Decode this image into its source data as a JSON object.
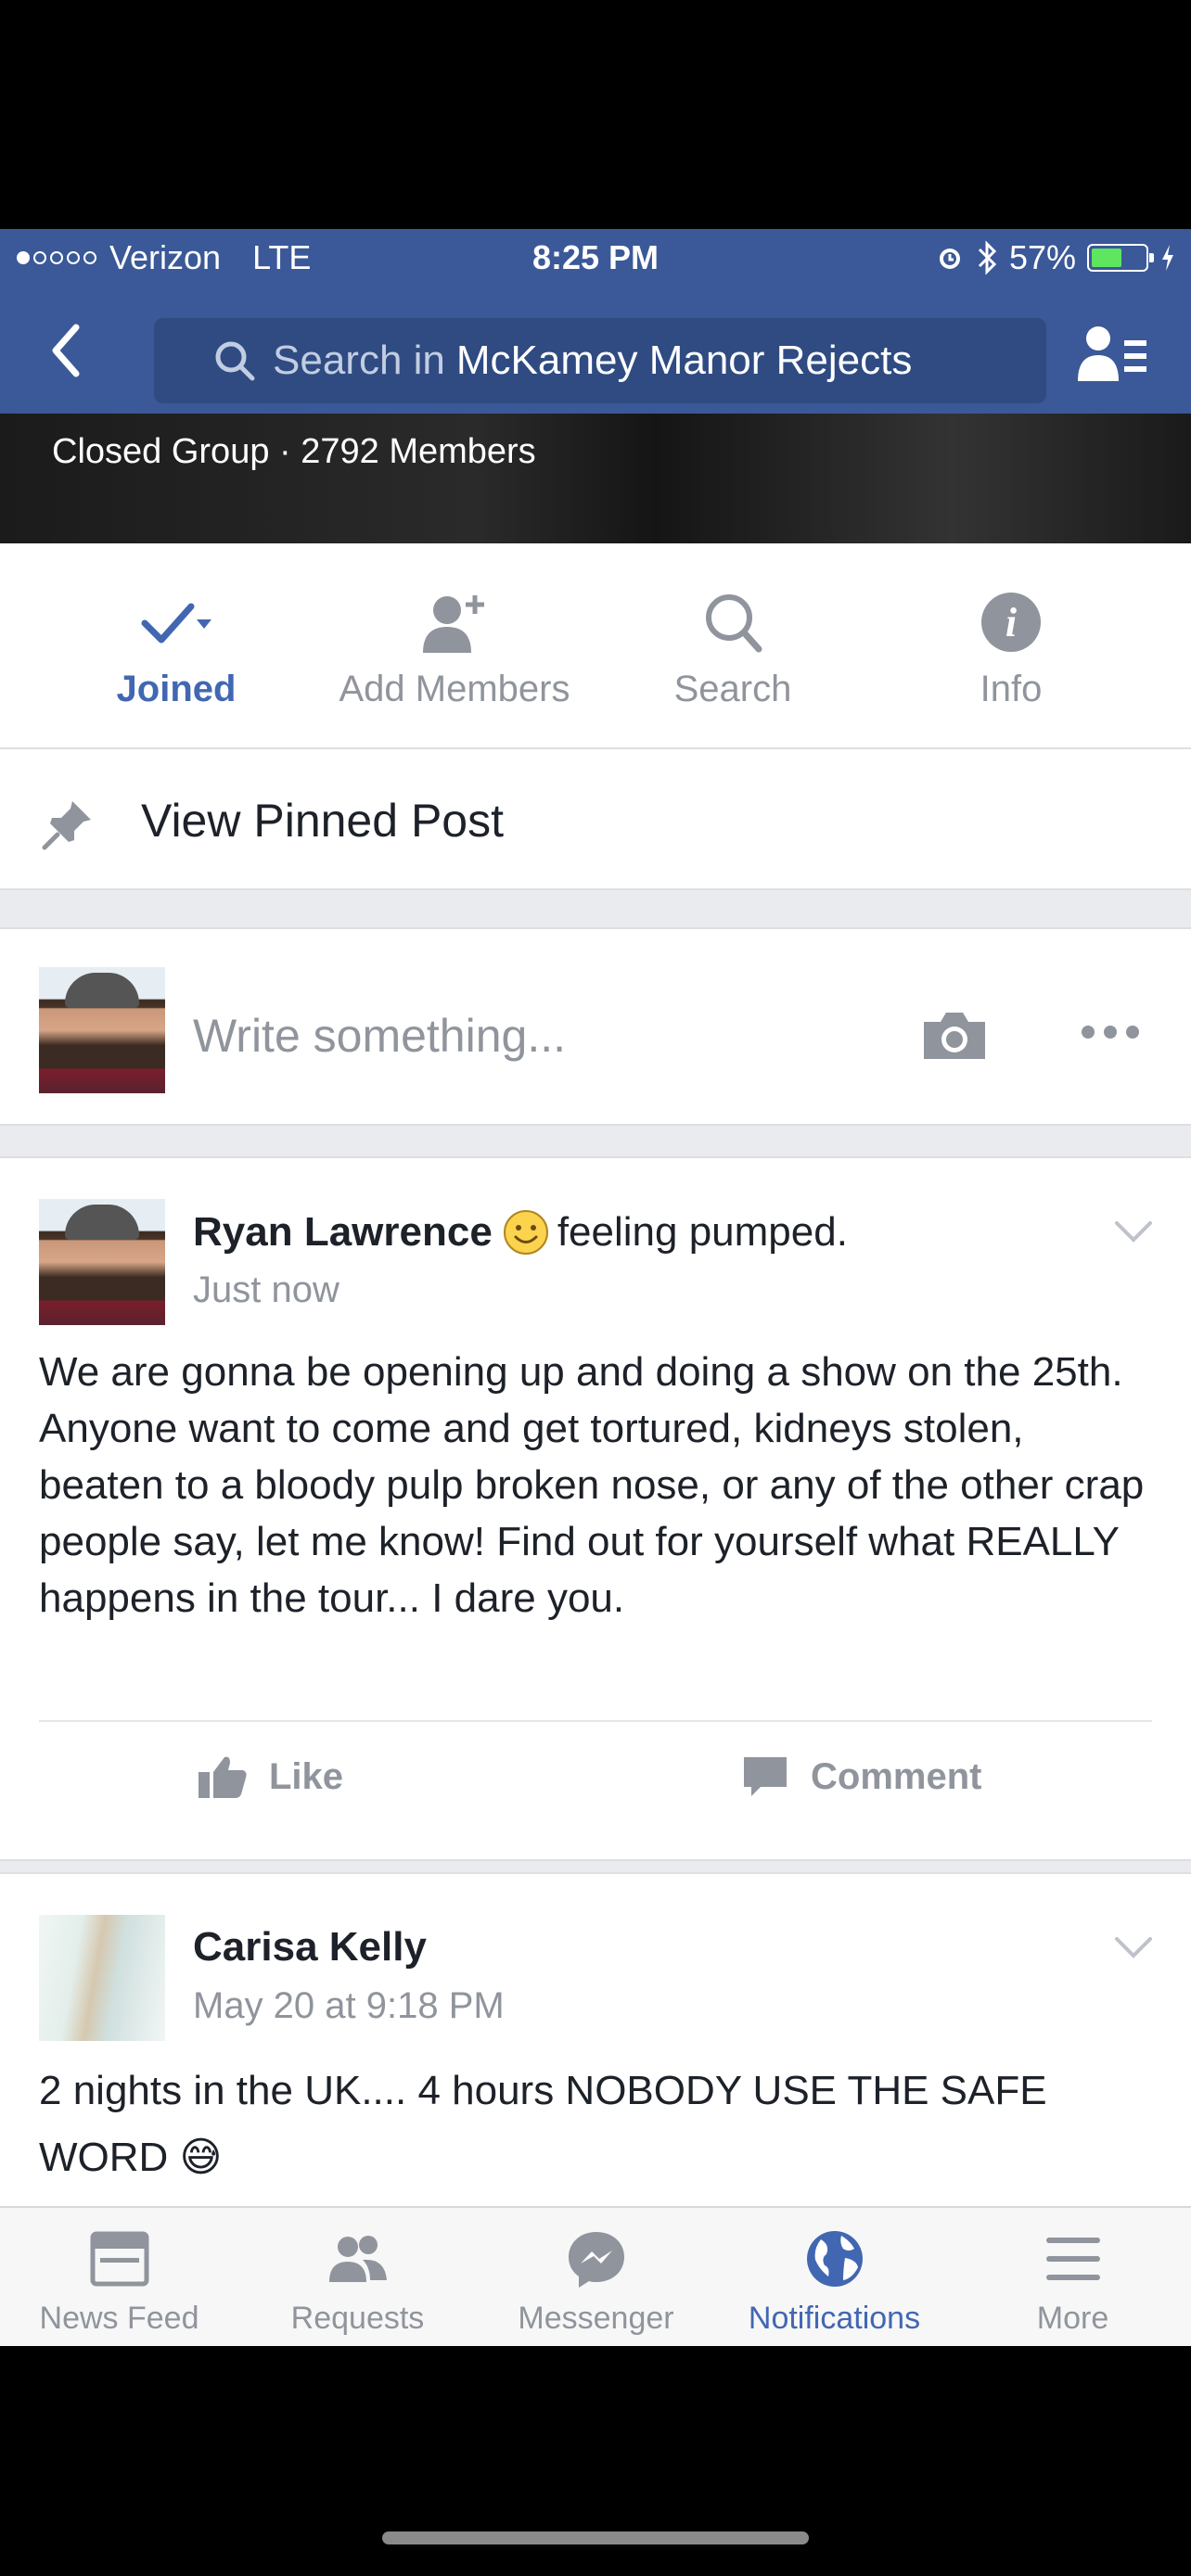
{
  "status_bar": {
    "carrier": "Verizon",
    "network": "LTE",
    "time": "8:25 PM",
    "battery_percent": "57%",
    "battery_level": 0.57,
    "signal_bars_filled": 1,
    "signal_bars_total": 5
  },
  "nav": {
    "search_prefix": "Search in",
    "group_name": "McKamey Manor Rejects"
  },
  "group": {
    "meta": "Closed Group · 2792 Members"
  },
  "actions": [
    {
      "label": "Joined"
    },
    {
      "label": "Add Members"
    },
    {
      "label": "Search"
    },
    {
      "label": "Info"
    }
  ],
  "pinned": {
    "label": "View Pinned Post"
  },
  "composer": {
    "placeholder": "Write something..."
  },
  "posts": [
    {
      "author": "Ryan Lawrence",
      "feeling": "feeling pumped.",
      "time": "Just now",
      "text": "We are gonna be opening up and doing a show on the 25th. Anyone want to come and get tortured, kidneys stolen, beaten to a bloody pulp broken nose, or any of the other crap people say, let me know! Find out for yourself what REALLY happens in the tour... I dare you.",
      "like_label": "Like",
      "comment_label": "Comment"
    },
    {
      "author": "Carisa Kelly",
      "time": "May 20 at 9:18 PM",
      "text": "2 nights in the UK.... 4 hours NOBODY USE THE SAFE WORD 😅"
    }
  ],
  "tabbar": [
    {
      "label": "News Feed"
    },
    {
      "label": "Requests"
    },
    {
      "label": "Messenger"
    },
    {
      "label": "Notifications",
      "active": true
    },
    {
      "label": "More"
    }
  ],
  "colors": {
    "facebook_blue": "#3b5998",
    "link_blue": "#4267b2",
    "muted_gray": "#90949c"
  }
}
